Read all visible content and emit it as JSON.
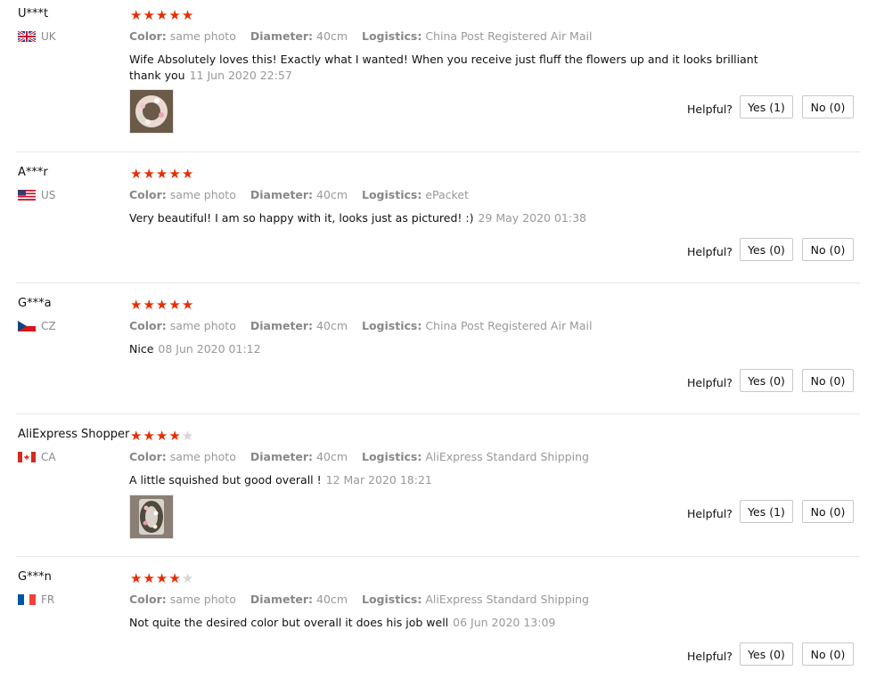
{
  "labels": {
    "color": "Color:",
    "diameter": "Diameter:",
    "logistics": "Logistics:",
    "helpful": "Helpful?"
  },
  "reviews": [
    {
      "user": "U***t",
      "country": "UK",
      "rating": 5,
      "color": "same photo",
      "diameter": "40cm",
      "logistics": "China Post Registered Air Mail",
      "text": "Wife Absolutely loves this! Exactly what I wanted! When you receive just fluff the flowers up and it looks brilliant thank you",
      "date": "11 Jun 2020 22:57",
      "has_photo": true,
      "yes": "Yes (1)",
      "no": "No (0)"
    },
    {
      "user": "A***r",
      "country": "US",
      "rating": 5,
      "color": "same photo",
      "diameter": "40cm",
      "logistics": "ePacket",
      "text": "Very beautiful! I am so happy with it, looks just as pictured! :)",
      "date": "29 May 2020 01:38",
      "has_photo": false,
      "yes": "Yes (0)",
      "no": "No (0)"
    },
    {
      "user": "G***a",
      "country": "CZ",
      "rating": 5,
      "color": "same photo",
      "diameter": "40cm",
      "logistics": "China Post Registered Air Mail",
      "text": "Nice",
      "date": "08 Jun 2020 01:12",
      "has_photo": false,
      "yes": "Yes (0)",
      "no": "No (0)"
    },
    {
      "user": "AliExpress Shopper",
      "country": "CA",
      "rating": 4,
      "color": "same photo",
      "diameter": "40cm",
      "logistics": "AliExpress Standard Shipping",
      "text": "A little squished but good overall !",
      "date": "12 Mar 2020 18:21",
      "has_photo": true,
      "yes": "Yes (1)",
      "no": "No (0)"
    },
    {
      "user": "G***n",
      "country": "FR",
      "rating": 4,
      "color": "same photo",
      "diameter": "40cm",
      "logistics": "AliExpress Standard Shipping",
      "text": "Not quite the desired color but overall it does his job well",
      "date": "06 Jun 2020 13:09",
      "has_photo": false,
      "yes": "Yes (0)",
      "no": "No (0)"
    }
  ],
  "colors": {
    "star_on": "#e62e04",
    "star_off": "#d6d6d6",
    "muted_text": "#999999"
  },
  "icons": {
    "star": "star-icon",
    "flag_uk": "flag-uk-icon",
    "flag_us": "flag-us-icon",
    "flag_cz": "flag-cz-icon",
    "flag_ca": "flag-ca-icon",
    "flag_fr": "flag-fr-icon"
  }
}
